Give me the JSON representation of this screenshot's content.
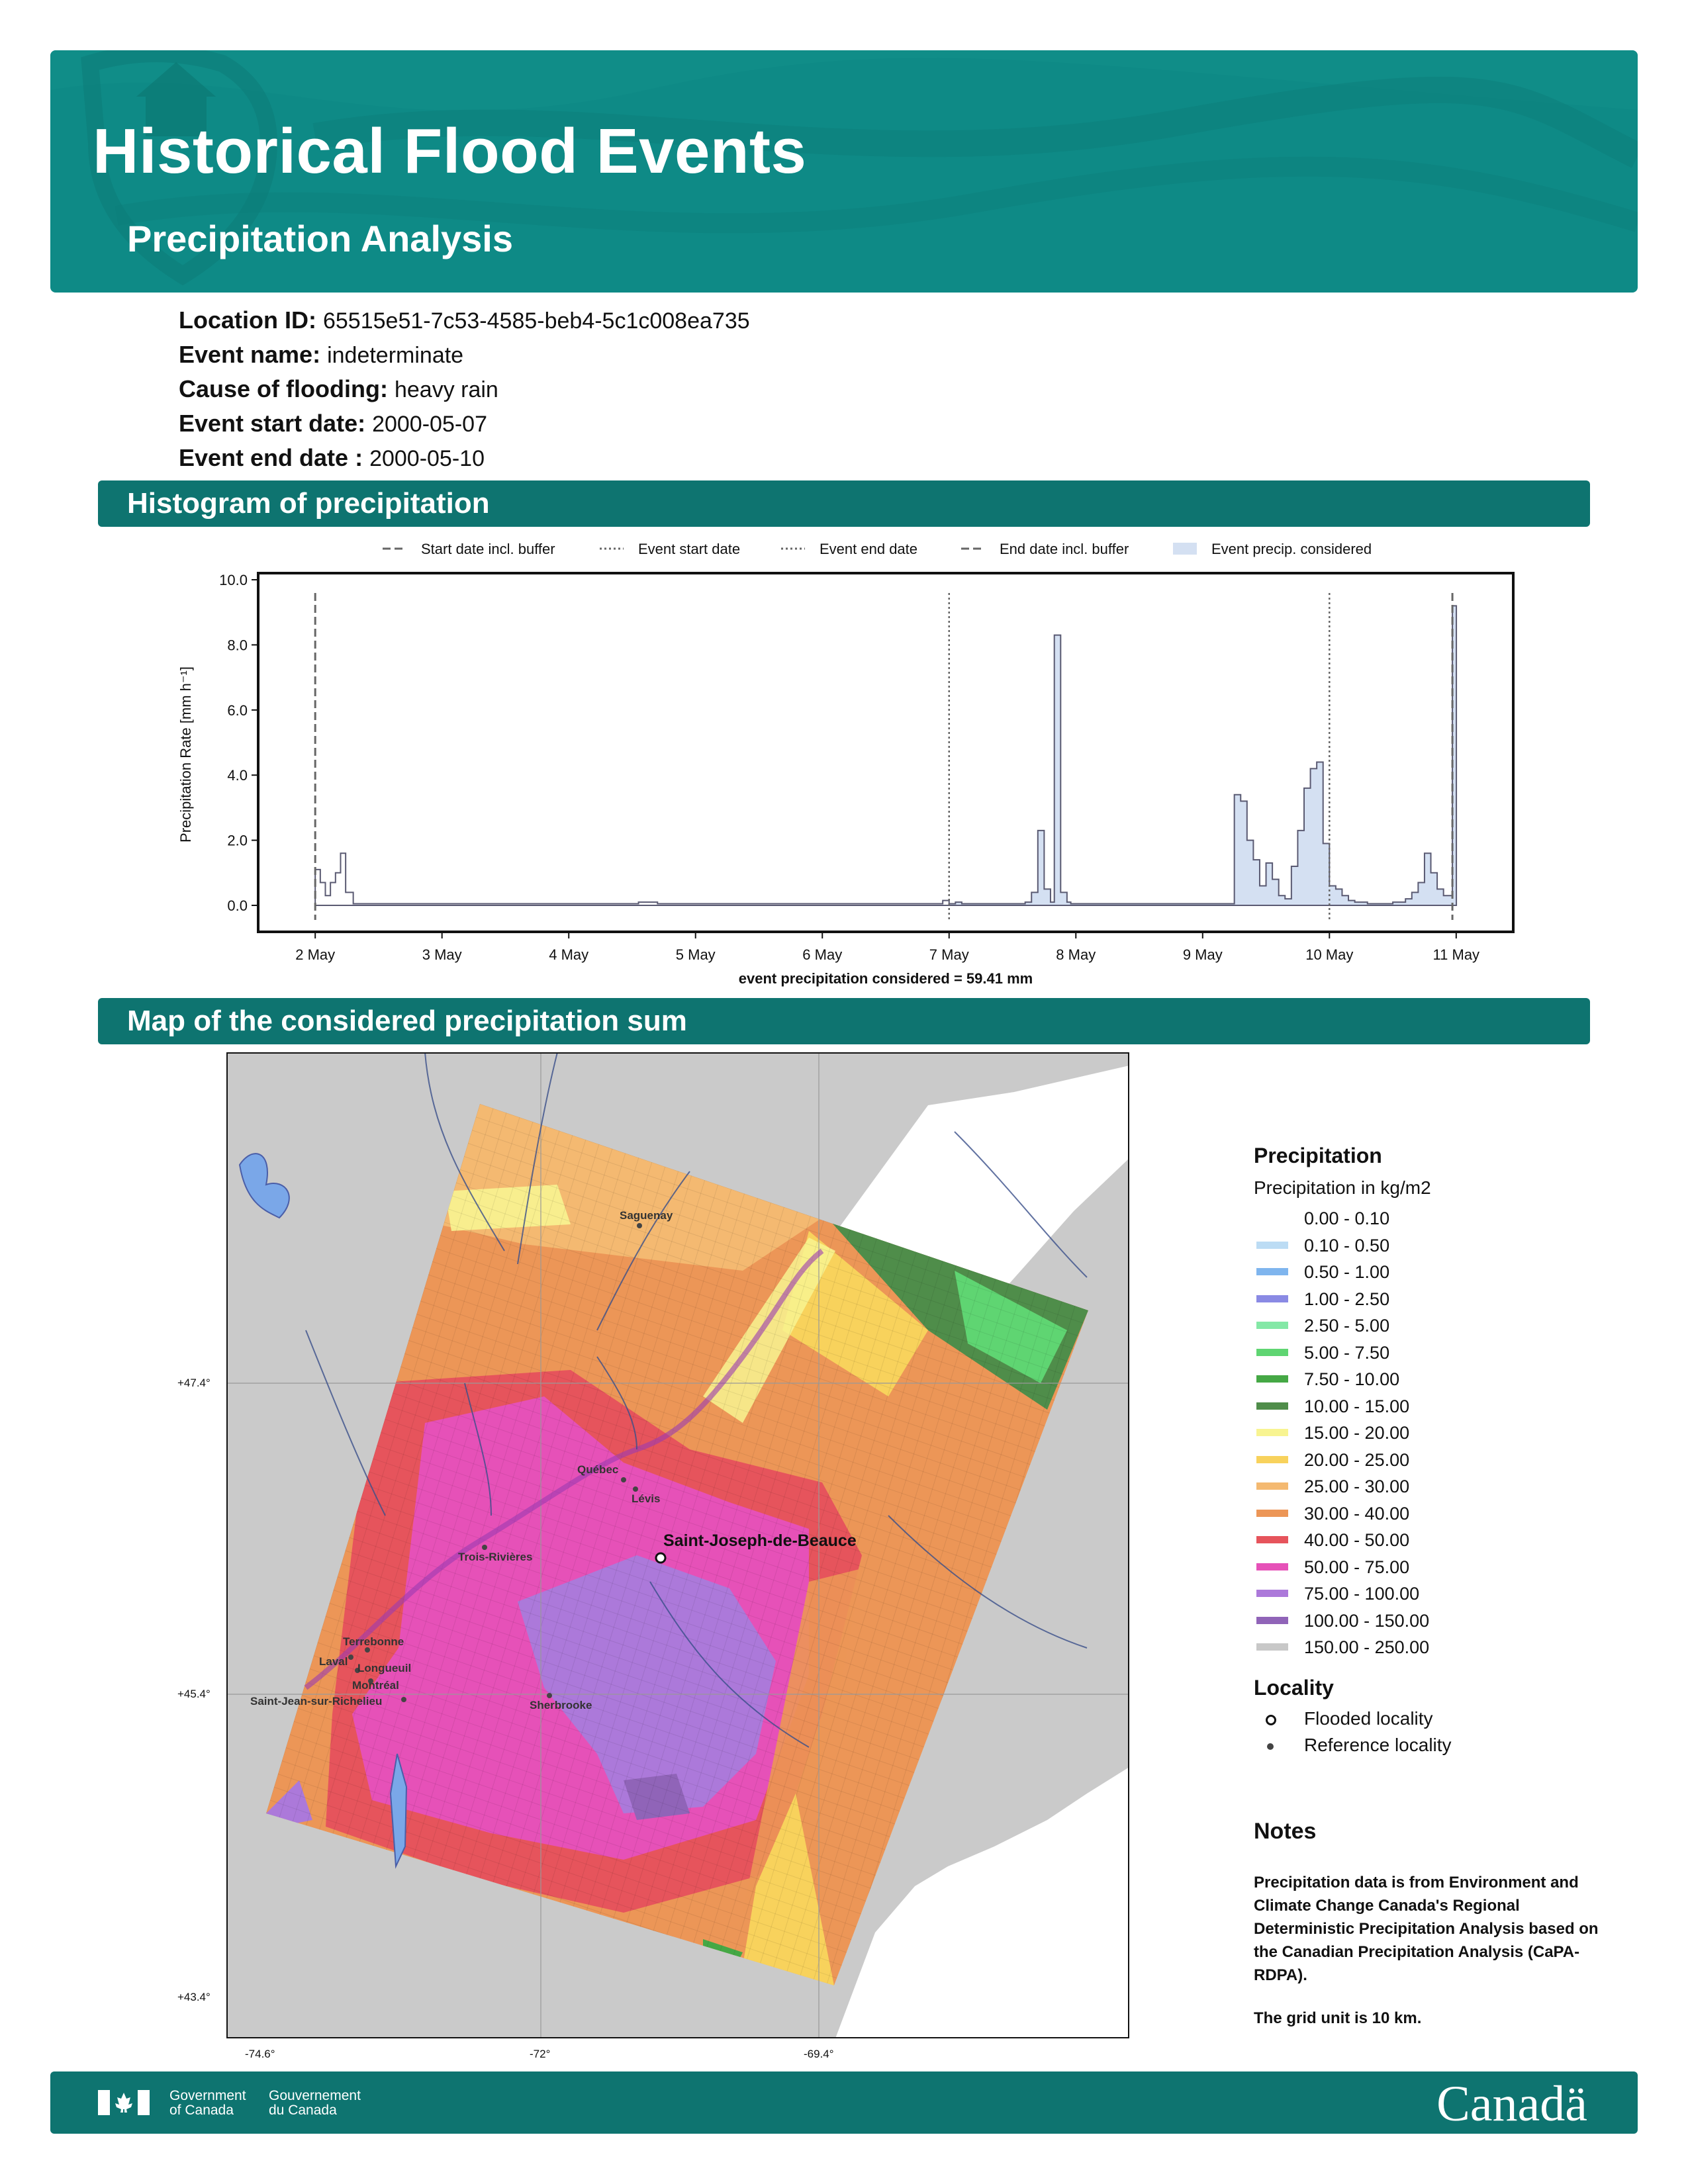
{
  "header": {
    "title": "Historical Flood Events",
    "subtitle": "Precipitation Analysis"
  },
  "event": {
    "location_id_label": "Location ID:",
    "location_id": "65515e51-7c53-4585-beb4-5c1c008ea735",
    "event_name_label": "Event name:",
    "event_name": "indeterminate",
    "cause_label": "Cause of flooding:",
    "cause": "heavy rain",
    "start_label": "Event start date:",
    "start": "2000-05-07",
    "end_label": "Event end date :",
    "end": "2000-05-10"
  },
  "sections": {
    "histogram": "Histogram of precipitation",
    "map": "Map of the considered precipitation sum"
  },
  "chart_data": {
    "type": "area",
    "title": "",
    "xlabel": "",
    "ylabel": "Precipitation Rate [mm h⁻¹]",
    "ylim": [
      0,
      10
    ],
    "yticks": [
      "0.0",
      "2.0",
      "4.0",
      "6.0",
      "8.0",
      "10.0"
    ],
    "xlim": [
      -0.45,
      9.45
    ],
    "xticks": [
      "2 May",
      "3 May",
      "4 May",
      "5 May",
      "6 May",
      "7 May",
      "8 May",
      "9 May",
      "10 May",
      "11 May"
    ],
    "legend": {
      "placement": "top",
      "items": [
        "Start date incl. buffer",
        "Event start date",
        "Event end date",
        "End date incl. buffer",
        "Event precip. considered"
      ]
    },
    "vlines": {
      "start_incl_buffer": 0,
      "event_start": 5,
      "event_end": 8,
      "end_incl_buffer": 8.97
    },
    "footnote": "event precipitation considered = 59.41 mm",
    "grid": false,
    "series": [
      {
        "x": [
          0.0,
          0.04,
          0.08,
          0.12,
          0.16,
          0.2,
          0.24,
          0.3,
          0.5,
          1.0,
          2.0,
          2.5,
          2.55,
          2.7,
          3.0,
          4.0,
          4.9,
          4.95,
          5.0,
          5.05,
          5.1,
          5.5,
          5.6,
          5.65,
          5.7,
          5.75,
          5.8,
          5.83,
          5.88,
          5.93,
          5.96,
          6.0,
          6.05,
          6.1,
          6.5,
          7.0,
          7.2,
          7.25,
          7.3,
          7.35,
          7.4,
          7.45,
          7.5,
          7.55,
          7.6,
          7.65,
          7.7,
          7.75,
          7.8,
          7.85,
          7.9,
          7.95,
          8.0,
          8.05,
          8.1,
          8.15,
          8.2,
          8.3,
          8.4,
          8.5,
          8.6,
          8.65,
          8.7,
          8.75,
          8.8,
          8.85,
          8.9,
          8.95,
          8.97
        ],
        "y": [
          1.1,
          0.7,
          0.3,
          0.7,
          1.0,
          1.6,
          0.4,
          0.05,
          0.05,
          0.05,
          0.05,
          0.05,
          0.1,
          0.05,
          0.05,
          0.05,
          0.05,
          0.15,
          0.05,
          0.1,
          0.05,
          0.05,
          0.1,
          0.4,
          2.3,
          0.5,
          0.1,
          8.3,
          0.4,
          0.1,
          0.05,
          0.05,
          0.05,
          0.05,
          0.05,
          0.05,
          0.05,
          3.4,
          3.2,
          2.0,
          1.4,
          0.6,
          1.3,
          0.8,
          0.3,
          0.2,
          1.2,
          2.3,
          3.6,
          4.2,
          4.4,
          1.9,
          0.6,
          0.5,
          0.3,
          0.15,
          0.1,
          0.05,
          0.05,
          0.1,
          0.2,
          0.4,
          0.7,
          1.6,
          1.0,
          0.5,
          0.3,
          0.3,
          9.2
        ]
      }
    ]
  },
  "map": {
    "lat_labels": [
      "+47.4°",
      "+45.4°",
      "+43.4°"
    ],
    "lon_labels": [
      "-74.6°",
      "-72°",
      "-69.4°"
    ],
    "flooded_locality": "Saint-Joseph-de-Beauce",
    "reference_localities": [
      "Saguenay",
      "Québec",
      "Lévis",
      "Trois-Rivières",
      "Terrebonne",
      "Laval",
      "Longueuil",
      "Montréal",
      "Saint-Jean-sur-Richelieu",
      "Sherbrooke"
    ]
  },
  "legend": {
    "title": "Precipitation",
    "subtitle": "Precipitation in kg/m2",
    "classes": [
      {
        "label": "0.00 - 0.10",
        "color": "#ffffff"
      },
      {
        "label": "0.10 - 0.50",
        "color": "#bcdcf4"
      },
      {
        "label": "0.50 - 1.00",
        "color": "#7fb5ee"
      },
      {
        "label": "1.00 - 2.50",
        "color": "#8a8ae4"
      },
      {
        "label": "2.50 - 5.00",
        "color": "#84e8a6"
      },
      {
        "label": "5.00 - 7.50",
        "color": "#5fd572"
      },
      {
        "label": "7.50 - 10.00",
        "color": "#45a845"
      },
      {
        "label": "10.00 - 15.00",
        "color": "#4f8d4a"
      },
      {
        "label": "15.00 - 20.00",
        "color": "#f8f491"
      },
      {
        "label": "20.00 - 25.00",
        "color": "#f8d25c"
      },
      {
        "label": "25.00 - 30.00",
        "color": "#f4b971"
      },
      {
        "label": "30.00 - 40.00",
        "color": "#ec9657"
      },
      {
        "label": "40.00 - 50.00",
        "color": "#e6545c"
      },
      {
        "label": "50.00 - 75.00",
        "color": "#e651b8"
      },
      {
        "label": "75.00 - 100.00",
        "color": "#ac79da"
      },
      {
        "label": "100.00 - 150.00",
        "color": "#9064b8"
      },
      {
        "label": "150.00 - 250.00",
        "color": "#c8c8c8"
      }
    ],
    "locality_title": "Locality",
    "flooded_label": "Flooded locality",
    "reference_label": "Reference locality"
  },
  "notes": {
    "title": "Notes",
    "text1": "Precipitation data is from Environment and Climate Change Canada's Regional Deterministic Precipitation Analysis based on the Canadian Precipitation Analysis (CaPA-RDPA).",
    "text2": "The grid unit is 10 km."
  },
  "footer": {
    "gov_en_1": "Government",
    "gov_en_2": "of Canada",
    "gov_fr_1": "Gouvernement",
    "gov_fr_2": "du Canada",
    "wordmark": "Canadä"
  }
}
